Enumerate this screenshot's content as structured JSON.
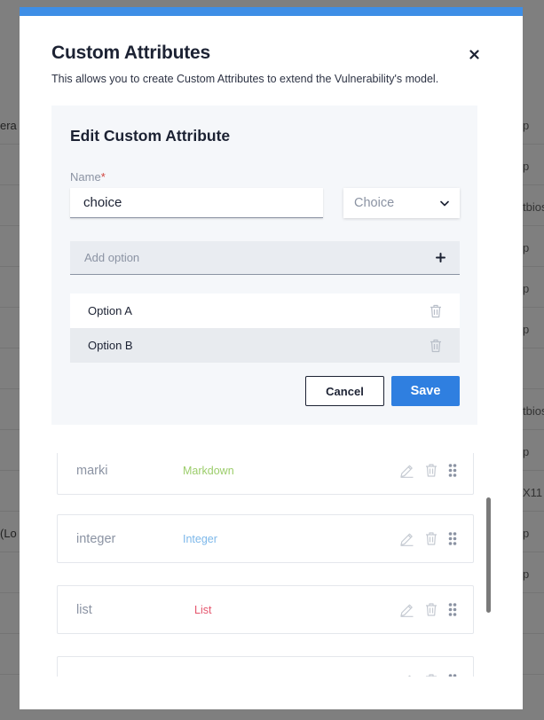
{
  "background": {
    "left_texts": [
      {
        "text": "era",
        "top": 0
      },
      {
        "text": "(Lo",
        "top": 0
      }
    ],
    "right_texts": [
      "p",
      "p",
      "tbios",
      "p",
      "p",
      "p",
      "tbios",
      "p",
      "X11",
      "p",
      "p"
    ]
  },
  "modal": {
    "title": "Custom Attributes",
    "description": "This allows you to create Custom Attributes to extend the Vulnerability's model.",
    "close_icon": "close-icon"
  },
  "edit": {
    "title": "Edit Custom Attribute",
    "name_label": "Name",
    "required_mark": "*",
    "name_value": "choice",
    "type_value": "Choice",
    "add_option_placeholder": "Add option",
    "options": [
      "Option A",
      "Option B"
    ],
    "cancel_label": "Cancel",
    "save_label": "Save"
  },
  "attributes": [
    {
      "name": "marki",
      "type": "Markdown",
      "type_color": "#9ccd6b"
    },
    {
      "name": "integer",
      "type": "Integer",
      "type_color": "#7db8ea"
    },
    {
      "name": "list",
      "type": "List",
      "type_color": "#e5566e"
    },
    {
      "name": "",
      "type": "",
      "type_color": "#8b93a3"
    }
  ],
  "colors": {
    "accent": "#3e8ee6",
    "save": "#2f7fe0",
    "required": "#d0443f"
  }
}
